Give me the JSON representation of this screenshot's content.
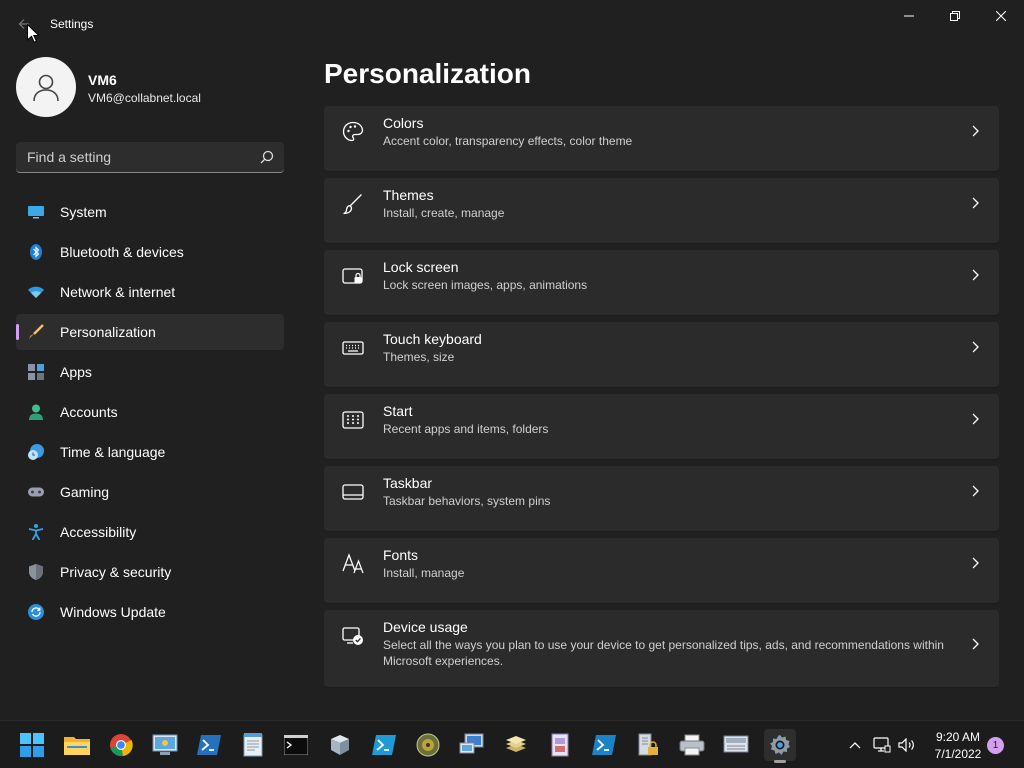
{
  "window": {
    "title": "Settings"
  },
  "profile": {
    "name": "VM6",
    "email": "VM6@collabnet.local"
  },
  "search": {
    "placeholder": "Find a setting"
  },
  "nav": [
    {
      "label": "System",
      "icon": "monitor-icon"
    },
    {
      "label": "Bluetooth & devices",
      "icon": "bluetooth-icon"
    },
    {
      "label": "Network & internet",
      "icon": "wifi-icon"
    },
    {
      "label": "Personalization",
      "icon": "brush-icon",
      "active": true
    },
    {
      "label": "Apps",
      "icon": "apps-icon"
    },
    {
      "label": "Accounts",
      "icon": "person-icon"
    },
    {
      "label": "Time & language",
      "icon": "globe-clock-icon"
    },
    {
      "label": "Gaming",
      "icon": "gamepad-icon"
    },
    {
      "label": "Accessibility",
      "icon": "accessibility-icon"
    },
    {
      "label": "Privacy & security",
      "icon": "shield-icon"
    },
    {
      "label": "Windows Update",
      "icon": "refresh-icon"
    }
  ],
  "page": {
    "title": "Personalization"
  },
  "cards": [
    {
      "title": "Colors",
      "desc": "Accent color, transparency effects, color theme",
      "icon": "palette-icon"
    },
    {
      "title": "Themes",
      "desc": "Install, create, manage",
      "icon": "pen-icon"
    },
    {
      "title": "Lock screen",
      "desc": "Lock screen images, apps, animations",
      "icon": "lock-screen-icon"
    },
    {
      "title": "Touch keyboard",
      "desc": "Themes, size",
      "icon": "keyboard-icon"
    },
    {
      "title": "Start",
      "desc": "Recent apps and items, folders",
      "icon": "start-grid-icon"
    },
    {
      "title": "Taskbar",
      "desc": "Taskbar behaviors, system pins",
      "icon": "taskbar-icon"
    },
    {
      "title": "Fonts",
      "desc": "Install, manage",
      "icon": "fonts-icon"
    },
    {
      "title": "Device usage",
      "desc": "Select all the ways you plan to use your device to get personalized tips, ads, and recommendations within Microsoft experiences.",
      "icon": "device-usage-icon"
    }
  ],
  "taskbar": {
    "apps": [
      "start-icon",
      "file-explorer-icon",
      "chrome-icon",
      "network-config-icon",
      "powershell-icon",
      "notepad-icon",
      "terminal-icon",
      "tools-icon",
      "powershell-ise-icon",
      "disk-icon",
      "remote-desktop-icon",
      "stack-icon",
      "registry-icon",
      "powershell-alt-icon",
      "server-lock-icon",
      "printer-icon",
      "computer-management-icon",
      "settings-icon"
    ],
    "time": "9:20 AM",
    "date": "7/1/2022",
    "notifications": "1"
  },
  "colors": {
    "accent": "#d69ef2",
    "background": "#202020",
    "card": "#2b2b2b"
  }
}
